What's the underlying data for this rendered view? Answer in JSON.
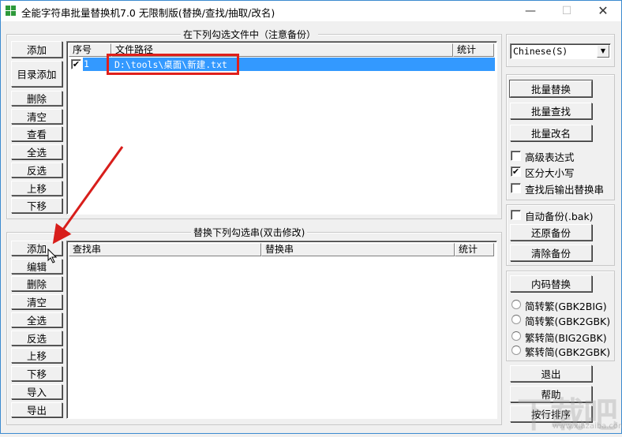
{
  "window": {
    "title": "全能字符串批量替换机7.0 无限制版(替换/查找/抽取/改名)",
    "controls": {
      "minimize": "—",
      "maximize": "☐",
      "close": "✕"
    }
  },
  "files_panel": {
    "title": "在下列勾选文件中（注意备份）",
    "buttons": [
      "添加",
      "目录添加",
      "删除",
      "清空",
      "查看",
      "全选",
      "反选",
      "上移",
      "下移"
    ],
    "columns": [
      "序号",
      "文件路径",
      "统计"
    ],
    "rows": [
      {
        "checked": true,
        "index": "1",
        "path": "D:\\tools\\桌面\\新建.txt",
        "count": ""
      }
    ]
  },
  "replace_panel": {
    "title": "替换下列勾选串(双击修改)",
    "buttons": [
      "添加",
      "编辑",
      "删除",
      "清空",
      "全选",
      "反选",
      "上移",
      "下移",
      "导入",
      "导出"
    ],
    "columns": [
      "查找串",
      "替换串",
      "统计"
    ],
    "rows": []
  },
  "language_select": {
    "value": "Chinese(S)"
  },
  "actions": {
    "buttons": [
      "批量替换",
      "批量查找",
      "批量改名"
    ],
    "options": [
      {
        "label": "高级表达式",
        "checked": false
      },
      {
        "label": "区分大小写",
        "checked": true
      },
      {
        "label": "查找后输出替换串",
        "checked": false
      }
    ]
  },
  "backup": {
    "auto_backup": {
      "label": "自动备份(.bak)",
      "checked": false
    },
    "restore_label": "还原备份",
    "clear_label": "清除备份"
  },
  "encoding": {
    "button_label": "内码替换",
    "options": [
      {
        "label": "简转繁(GBK2BIG)",
        "selected": false
      },
      {
        "label": "简转繁(GBK2GBK)",
        "selected": false
      },
      {
        "label": "繁转简(BIG2GBK)",
        "selected": false
      },
      {
        "label": "繁转简(GBK2GBK)",
        "selected": false
      }
    ]
  },
  "bottom_buttons": {
    "exit": "退出",
    "help": "帮助",
    "sort": "按行排序"
  },
  "watermark": {
    "text": "下载吧",
    "url": "www.xiazaiba.com"
  },
  "colors": {
    "selection": "#3399ff",
    "annotation": "#e0201c"
  }
}
